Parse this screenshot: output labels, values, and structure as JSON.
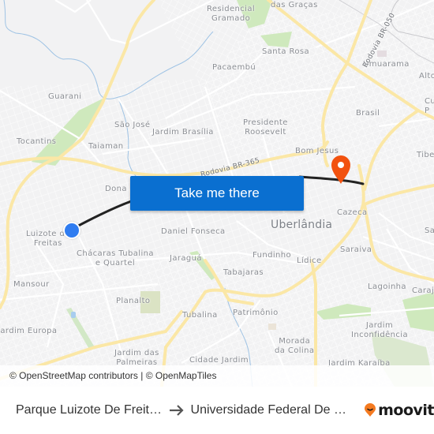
{
  "map": {
    "labels": {
      "residencial_gramado": "Residencial\nGramado",
      "das_gracas": "das Graças",
      "santa_rosa": "Santa Rosa",
      "umuarama": "Umuarama",
      "alto": "Alto",
      "pacaembu": "Pacaembú",
      "guarani": "Guarani",
      "sao_jose": "São José",
      "jardim_brasilia": "Jardim Brasília",
      "presidente_roosevelt": "Presidente\nRoosevelt",
      "brasil": "Brasil",
      "cu": "Cu\nP",
      "tocantins": "Tocantins",
      "taiaman": "Taiaman",
      "bom_jesus": "Bom Jesus",
      "tibery": "Tibe",
      "dona": "Dona",
      "luizote_de_freitas": "Luizote de\nFreitas",
      "chacaras_tubalina": "Chácaras Tubalina\ne Quartel",
      "daniel_fonseca": "Daniel Fonseca",
      "uberlandia": "Uberlândia",
      "cazeca": "Cazeca",
      "sa": "Sa",
      "jaragua": "Jaraguá",
      "fundinho": "Fundinho",
      "lidice": "Lídice",
      "saraiva": "Saraiva",
      "mansour": "Mansour",
      "tabajaras": "Tabajaras",
      "lagoinha": "Lagoinha",
      "caraja": "Caraj",
      "planalto": "Planalto",
      "tubalina": "Tubalina",
      "patrimonio": "Patrimônio",
      "jardim_europa": "Jardim Europa",
      "jardim_inconfidencia": "Jardim\nInconfidência",
      "morada_da_colina": "Morada\nda Colina",
      "jardim_das_palmeiras": "Jardim das\nPalmeiras",
      "cidade_jardim": "Cidade Jardim",
      "jardim_karaiba": "Jardim Karaíba",
      "road_br365": "Rodovia BR-365",
      "road_br050": "Rodovia BR-050"
    },
    "origin_marker": "origin-dot",
    "destination_marker": "destination-pin",
    "colors": {
      "background": "#f2f2f3",
      "major_road": "#fbe7a6",
      "park": "#cfe9bd",
      "water": "#9fc3e4",
      "route": "#222222",
      "origin": "#2f7cf0",
      "destination": "#f2520f",
      "cta": "#0a6fd0"
    }
  },
  "cta": {
    "label": "Take me there"
  },
  "attribution": {
    "text": "© OpenStreetMap contributors | © OpenMapTiles"
  },
  "footer": {
    "from": "Parque Luizote De Freit…",
    "to": "Universidade Federal De …",
    "brand": "moovit"
  }
}
